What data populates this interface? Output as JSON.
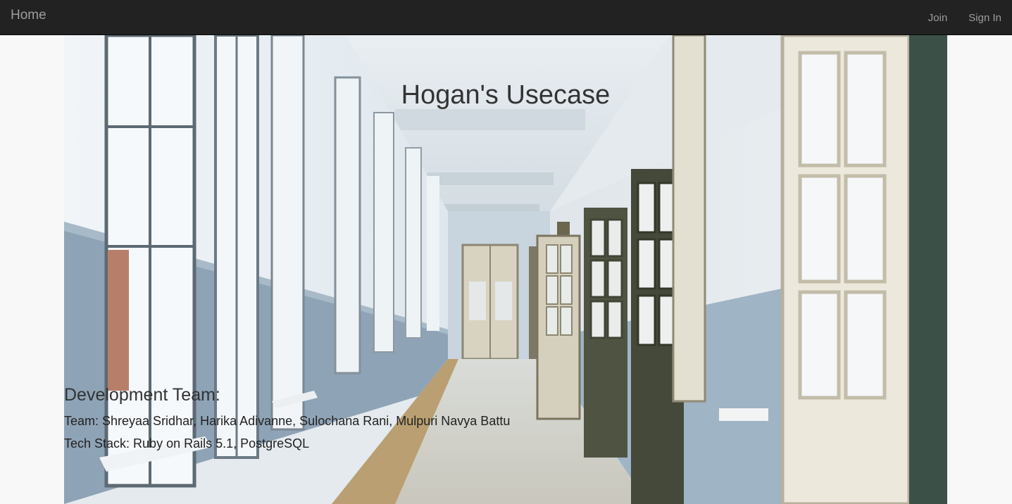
{
  "nav": {
    "brand": "Home",
    "links": [
      {
        "label": "Join"
      },
      {
        "label": "Sign In"
      }
    ]
  },
  "hero": {
    "title": "Hogan's Usecase",
    "image_subject": "school corridor with windows and open doors"
  },
  "team": {
    "heading": "Development Team:",
    "members_line": "Team: Shreyaa Sridhar, Harika Adivanne, Sulochana Rani, Mulpuri Navya Battu",
    "tech_line": "Tech Stack: Ruby on Rails 5.1, PostgreSQL"
  },
  "colors": {
    "navbar_bg": "#222222",
    "nav_text": "#9d9d9d",
    "page_bg": "#f8f8f8",
    "title_text": "#333333"
  }
}
